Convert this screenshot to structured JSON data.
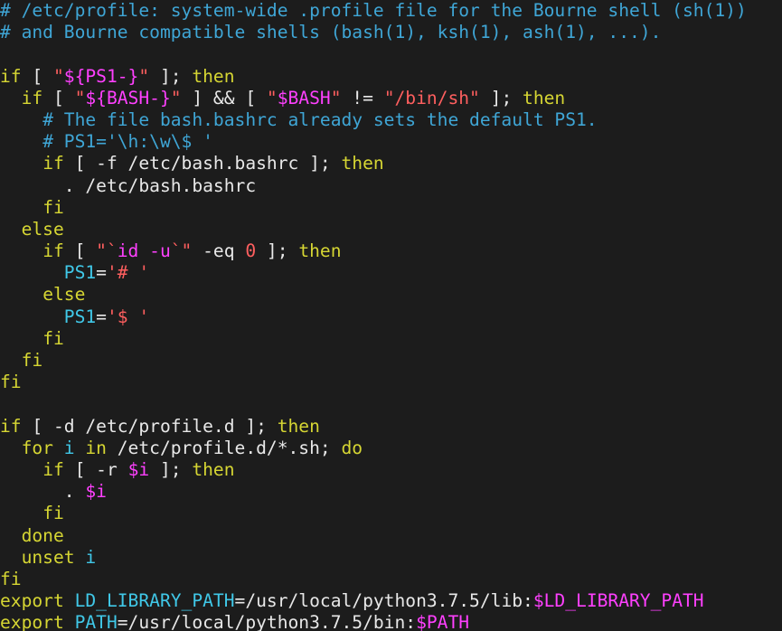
{
  "colors": {
    "background": "#1c1c1c",
    "comment": "#3fa6d6",
    "keyword": "#d6d633",
    "string": "#ff5f5f",
    "variable": "#ff40ff",
    "ident": "#40c8e8",
    "path": "#e8e8e8",
    "plain": "#e8e8e8",
    "number": "#ff5f5f"
  },
  "lines": [
    [
      [
        "comment",
        "# /etc/profile: system-wide .profile file for the Bourne shell (sh(1))"
      ]
    ],
    [
      [
        "comment",
        "# and Bourne compatible shells (bash(1), ksh(1), ash(1), ...)."
      ]
    ],
    [],
    [
      [
        "keyword",
        "if"
      ],
      [
        "plain",
        " [ "
      ],
      [
        "string",
        "\""
      ],
      [
        "variable",
        "${PS1-}"
      ],
      [
        "string",
        "\""
      ],
      [
        "plain",
        " ]; "
      ],
      [
        "keyword",
        "then"
      ]
    ],
    [
      [
        "plain",
        "  "
      ],
      [
        "keyword",
        "if"
      ],
      [
        "plain",
        " [ "
      ],
      [
        "string",
        "\""
      ],
      [
        "variable",
        "${BASH-}"
      ],
      [
        "string",
        "\""
      ],
      [
        "plain",
        " ] && [ "
      ],
      [
        "string",
        "\""
      ],
      [
        "variable",
        "$BASH"
      ],
      [
        "string",
        "\""
      ],
      [
        "plain",
        " != "
      ],
      [
        "string",
        "\"/bin/sh\""
      ],
      [
        "plain",
        " ]; "
      ],
      [
        "keyword",
        "then"
      ]
    ],
    [
      [
        "plain",
        "    "
      ],
      [
        "comment",
        "# The file bash.bashrc already sets the default PS1."
      ]
    ],
    [
      [
        "plain",
        "    "
      ],
      [
        "comment",
        "# PS1='\\h:\\w\\$ '"
      ]
    ],
    [
      [
        "plain",
        "    "
      ],
      [
        "keyword",
        "if"
      ],
      [
        "plain",
        " [ -f /etc/bash.bashrc ]; "
      ],
      [
        "keyword",
        "then"
      ]
    ],
    [
      [
        "plain",
        "      . /etc/bash.bashrc"
      ]
    ],
    [
      [
        "plain",
        "    "
      ],
      [
        "keyword",
        "fi"
      ]
    ],
    [
      [
        "plain",
        "  "
      ],
      [
        "keyword",
        "else"
      ]
    ],
    [
      [
        "plain",
        "    "
      ],
      [
        "keyword",
        "if"
      ],
      [
        "plain",
        " [ "
      ],
      [
        "string",
        "\"`"
      ],
      [
        "variable",
        "id -u"
      ],
      [
        "string",
        "`\""
      ],
      [
        "plain",
        " -eq "
      ],
      [
        "number",
        "0"
      ],
      [
        "plain",
        " ]; "
      ],
      [
        "keyword",
        "then"
      ]
    ],
    [
      [
        "plain",
        "      "
      ],
      [
        "ident",
        "PS1"
      ],
      [
        "plain",
        "="
      ],
      [
        "string",
        "'# '"
      ]
    ],
    [
      [
        "plain",
        "    "
      ],
      [
        "keyword",
        "else"
      ]
    ],
    [
      [
        "plain",
        "      "
      ],
      [
        "ident",
        "PS1"
      ],
      [
        "plain",
        "="
      ],
      [
        "string",
        "'$ '"
      ]
    ],
    [
      [
        "plain",
        "    "
      ],
      [
        "keyword",
        "fi"
      ]
    ],
    [
      [
        "plain",
        "  "
      ],
      [
        "keyword",
        "fi"
      ]
    ],
    [
      [
        "keyword",
        "fi"
      ]
    ],
    [],
    [
      [
        "keyword",
        "if"
      ],
      [
        "plain",
        " [ -d /etc/profile.d ]; "
      ],
      [
        "keyword",
        "then"
      ]
    ],
    [
      [
        "plain",
        "  "
      ],
      [
        "keyword",
        "for"
      ],
      [
        "plain",
        " "
      ],
      [
        "ident",
        "i"
      ],
      [
        "plain",
        " "
      ],
      [
        "keyword",
        "in"
      ],
      [
        "plain",
        " /etc/profile.d/*.sh; "
      ],
      [
        "keyword",
        "do"
      ]
    ],
    [
      [
        "plain",
        "    "
      ],
      [
        "keyword",
        "if"
      ],
      [
        "plain",
        " [ -r "
      ],
      [
        "variable",
        "$i"
      ],
      [
        "plain",
        " ]; "
      ],
      [
        "keyword",
        "then"
      ]
    ],
    [
      [
        "plain",
        "      . "
      ],
      [
        "variable",
        "$i"
      ]
    ],
    [
      [
        "plain",
        "    "
      ],
      [
        "keyword",
        "fi"
      ]
    ],
    [
      [
        "plain",
        "  "
      ],
      [
        "keyword",
        "done"
      ]
    ],
    [
      [
        "plain",
        "  "
      ],
      [
        "keyword",
        "unset"
      ],
      [
        "plain",
        " "
      ],
      [
        "ident",
        "i"
      ]
    ],
    [
      [
        "keyword",
        "fi"
      ]
    ],
    [
      [
        "keyword",
        "export"
      ],
      [
        "plain",
        " "
      ],
      [
        "ident",
        "LD_LIBRARY_PATH"
      ],
      [
        "plain",
        "=/usr/local/python3.7.5/lib:"
      ],
      [
        "variable",
        "$LD_LIBRARY_PATH"
      ]
    ],
    [
      [
        "keyword",
        "export"
      ],
      [
        "plain",
        " "
      ],
      [
        "ident",
        "PATH"
      ],
      [
        "plain",
        "=/usr/local/python3.7.5/bin:"
      ],
      [
        "variable",
        "$PATH"
      ]
    ]
  ]
}
